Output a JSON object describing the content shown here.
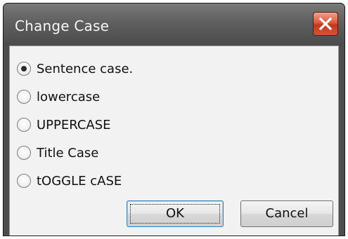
{
  "window": {
    "title": "Change Case",
    "close_icon": "close-icon",
    "close_color": "#c9452a"
  },
  "options": [
    {
      "label": "Sentence case.",
      "checked": true
    },
    {
      "label": "lowercase",
      "checked": false
    },
    {
      "label": "UPPERCASE",
      "checked": false
    },
    {
      "label": "Title Case",
      "checked": false
    },
    {
      "label": "tOGGLE cASE",
      "checked": false
    }
  ],
  "buttons": {
    "ok_label": "OK",
    "cancel_label": "Cancel"
  }
}
